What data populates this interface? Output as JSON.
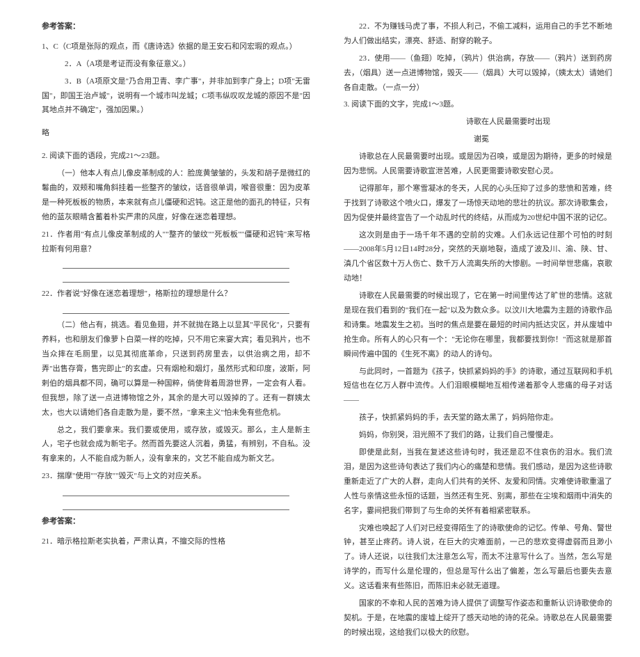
{
  "left": {
    "ans_label": "参考答案：",
    "a1": "1、C（C项是张际的观点，而《唐诗选》依据的是王安石和冈宏瑕的观点。）",
    "a2": "2．A（A项是考证而没有象征意义。）",
    "a3": "3．B（A项原文是\"乃合用卫青、李广事\"，并非加到李广身上；D项\"无雷国\"，即国王治卢城\"，说明有一个城市叫龙城；C项韦纵叹叹龙城的原因不是\"因其地点并不确定\"，强加因果。）",
    "lue": "略",
    "q2": "2. 阅读下面的语段，完成21～23题。",
    "p1": "（一）他本人有点儿像皮革制成的人：脸庞黄皱皱的，头发和胡子是微红的鬈曲的，双颊和嘴角斜挂着一些整齐的皱纹，话音很单调，喉音很重：因为皮革是一种死板板的物质，本来就有点儿僵硬和迟钝。这正是他的面孔的特征，只有他的蓝灰眼睛含蓄着朴实严肃的风度，好像在迷恋着理想。",
    "q21": "21．作者用\"有点儿像皮革制成的人\"\"整齐的皱纹\"\"死板板\"\"僵硬和迟钝\"来写格拉斯有何用意？",
    "q22": "22．作者说\"好像在迷恋着理想\"，格斯拉的理想是什么？",
    "p2": "（二）他占有，挑选。看见鱼翅，并不就抛在路上以显其\"平民化\"，只要有养料，也和朋友们像萝卜白菜一样的吃掉，只不用它来宴大宾；看见鸦片，也不当众摔在毛厕里，以见其彻底革命，只送到药房里去，以供治病之用，却不弄\"出售存膏，售完即止\"的玄虚。只有烟枪和烟灯，虽然形式和印度，波斯，阿剌伯的烟具都不同，确可以算是一种国粹，倘使背着周游世界，一定会有人看。但我想，除了送一点进博物馆之外，其余的是大可以毁掉的了。还有一群姨太太，也大以请她们各自走散为是，要不然，\"拿来主义\"怕未免有些危机。",
    "p3": "总之，我们要拿来。我们要或使用，或存放，或毁灭。那么，主人是新主人，宅子也就会成为新宅子。然而首先要这人沉着，勇猛，有辨别，不自私。没有拿来的，人不能自成为新人，没有拿来的，文艺不能自成为新文艺。",
    "q23": "23．揣摩\"使用\"\"存放\"\"毁灭\"与上文的对应关系。",
    "ans_label2": "参考答案：",
    "a21": "21．暗示格拉斯老实执着，严肃认真，不擅交际的性格"
  },
  "right": {
    "r22": "22．不为赚钱马虎了事，不损人利己，不偷工减料，运用自己的手艺不断地为人们做出结实，漂亮、舒适、耐穿的靴子。",
    "r23": "23．使用——（鱼翅）吃掉，（鸦片）供治病，存放——（鸦片）送到药房去，（烟具）送一点进博物馆，毁灭——（烟具）大可以毁掉，（姨太太）请她们各自走散。（一点一分）",
    "q3": "3. 阅读下面的文字，完成1～3题。",
    "title": "诗歌在人民最需要时出现",
    "author": "谢冕",
    "t1": "诗歌总在人民最需要时出现。或是因为召唤，或是因为期待，更多的时候是因为悲悯。人民需要诗歌宣泄苦难，人民更需要诗歌安慰心灵。",
    "t2": "记得那年，那个寒雪凝冰的冬天，人民的心头压抑了过多的悲愤和苦难，终于找到了诗歌这个喷火口，爆发了一场惊天动地的悲壮的抗议。那次诗歌集会，因为促使并最终宣告了一个动乱时代的终结，从而成为20世纪中国不泯的记亿。",
    "t3": "这次则是由于一场千年不遇的空前的灾难。人们永远记住那个可怕的时刻——2008年5月12日14时28分，突然的天崩地裂，造成了波及川、渝、陕、甘、滇几个省区数十万人伤亡、数千万人流离失所的大惨剧。一时间举世悲痛，哀歌动地！",
    "t4": "诗歌在人民最需要的时候出现了，它在第一时间里传达了旷世的悲情。这就是现在我们看到的\"我们在一起\"以及为数众多。以汶川大地震为主题的诗歌作品和诗集。地震发生之初。当时的焦点是要在最短的时间内抵达灾区，并从废墟中抢生命。所有人的心只有一个：\"无论你在哪里，我都要找到你！\"而这就是那首瞬间传遍中国的《生死不离》的动人的诗句。",
    "t5": "与此同时，一首题为《孩子，快抓紧妈妈的手》的诗歌，通过互联网和手机短信也在亿万人群中流传。人们泪眼模糊地互相传递着那令人悲痛的母子对话——",
    "t6": "孩子，快抓紧妈妈的手，去天堂的路太黑了，妈妈陪你走。",
    "t7": "妈妈，你别哭，泪光照不了我们的路，让我们自己慢慢走。",
    "t8": "即使是此刻，当我在复述这些诗句时，我还是忍不住哀伤的泪水。我们流泪，是因为这些诗句表达了我们内心的痛楚和悲情。我们感动，是因为这些诗歌重新走近了广大的人群，走向人们共有的关怀、友爱和同情。灾难使诗歌重温了人性与亲情这些永恒的话题，当然还有生死、别离，那些在尘埃和烟雨中消失的名字，霎间把我们带到了与生命的关怀有着相紧密联系。",
    "t9": "灾难也唤起了人们对已经变得陌生了的诗歌使命的记忆。传单、号角、警世钟，甚至止疼药。诗人说，在巨大的灾难面前，一己的悲欢变得虚弱而且渺小了。诗人还说，以往我们太注意怎么写，而太不注意写什么了。当然，怎么写是诗学的，而写什么是伦理的，但总是写什么出了偏差，怎么写最后也要失去意义。这话看来有些陈旧，而陈旧未必就无道理。",
    "t10": "国家的不幸和人民的苦难为诗人提供了调整写作姿态和重新认识诗歌使命的契机。于是，在地震的废墟上绽开了感天动地的诗的花朵。诗歌总在人民最需要的时候出现，这给我们以极大的欣慰。"
  }
}
